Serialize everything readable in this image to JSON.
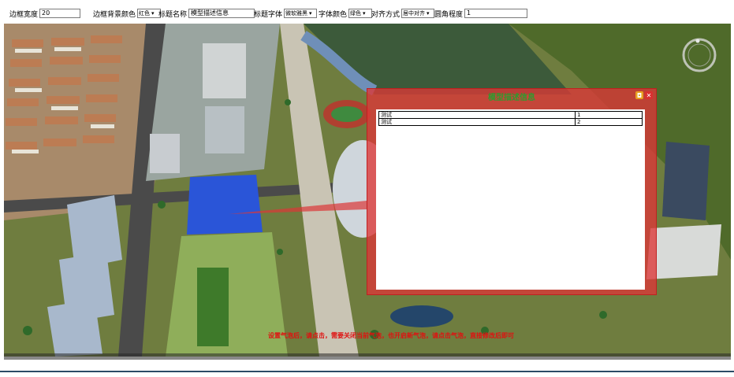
{
  "toolbar": {
    "border_width": {
      "label": "边框宽度",
      "value": "20"
    },
    "border_bg_color": {
      "label": "边框背景颜色",
      "value": "红色"
    },
    "title_name": {
      "label": "标题名称",
      "value": "模型描述信息"
    },
    "title_font": {
      "label": "标题字体",
      "value": "微软雅黑"
    },
    "font_color": {
      "label": "字体颜色",
      "value": "绿色"
    },
    "align": {
      "label": "对齐方式",
      "value": "居中对齐"
    },
    "corner_radius": {
      "label": "圆角程度",
      "value": "1"
    }
  },
  "popup": {
    "title": "模型描述信息",
    "rows": [
      {
        "name": "测试",
        "value": "1"
      },
      {
        "name": "测试",
        "value": "2"
      }
    ],
    "border_color": "#c02020",
    "title_color": "#2e9a2e"
  },
  "notice": "设置气泡后，请点击，需要关闭当前气泡，也开启新气泡，请点击气泡，直接修改后即可",
  "colors": {
    "accent_red": "#e01010",
    "caret_icon": "chevron-down-icon",
    "compass": "compass-icon"
  }
}
